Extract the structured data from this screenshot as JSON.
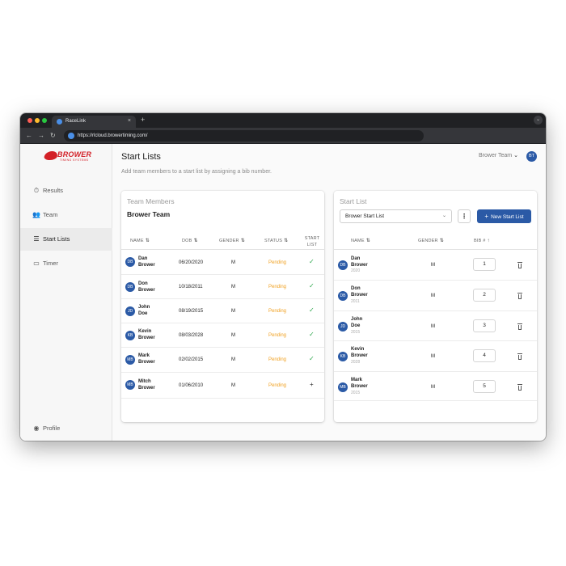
{
  "browser": {
    "tab_title": "RaceLink",
    "tab_close": "×",
    "new_tab": "+",
    "tab_menu": "⌄",
    "url": "https://rlcloud.browertiming.com/",
    "back": "←",
    "forward": "→",
    "reload": "↻"
  },
  "logo": {
    "brand": "BROWER",
    "sub": "TIMING SYSTEMS"
  },
  "sidebar": {
    "items": [
      {
        "label": "Results",
        "icon": "stopwatch-icon",
        "glyph": "⏱"
      },
      {
        "label": "Team",
        "icon": "team-icon",
        "glyph": "👥"
      },
      {
        "label": "Start Lists",
        "icon": "list-icon",
        "glyph": "☰"
      },
      {
        "label": "Timer",
        "icon": "camera-icon",
        "glyph": "▭"
      }
    ],
    "profile": {
      "label": "Profile",
      "glyph": "◉"
    }
  },
  "header": {
    "title": "Start Lists",
    "subtitle": "Add team members to a start list by assigning a bib number.",
    "team_switch": "Brower Team",
    "avatar": "BT"
  },
  "team_members": {
    "label": "Team Members",
    "team_name": "Brower Team",
    "columns": {
      "name": "NAME",
      "dob": "DOB",
      "gender": "GENDER",
      "status": "STATUS",
      "start_list_1": "START",
      "start_list_2": "LIST"
    },
    "sort_glyph": "⇅",
    "rows": [
      {
        "initials": "DB",
        "first": "Dan",
        "last": "Brower",
        "dob": "06/20/2020",
        "gender": "M",
        "status": "Pending",
        "action": "✓"
      },
      {
        "initials": "DB",
        "first": "Don",
        "last": "Brower",
        "dob": "10/18/2011",
        "gender": "M",
        "status": "Pending",
        "action": "✓"
      },
      {
        "initials": "JD",
        "first": "John",
        "last": "Doe",
        "dob": "08/19/2015",
        "gender": "M",
        "status": "Pending",
        "action": "✓"
      },
      {
        "initials": "KB",
        "first": "Kevin",
        "last": "Brower",
        "dob": "08/03/2028",
        "gender": "M",
        "status": "Pending",
        "action": "✓"
      },
      {
        "initials": "MB",
        "first": "Mark",
        "last": "Brower",
        "dob": "02/02/2015",
        "gender": "M",
        "status": "Pending",
        "action": "✓"
      },
      {
        "initials": "MB",
        "first": "Mitch",
        "last": "Brower",
        "dob": "01/06/2010",
        "gender": "M",
        "status": "Pending",
        "action": "+"
      }
    ]
  },
  "start_list": {
    "label": "Start List",
    "selected": "Brower Start List",
    "select_chevron": "⌄",
    "kebab": "⋮",
    "new_button": "New Start List",
    "new_plus": "+",
    "columns": {
      "name": "NAME",
      "gender": "GENDER",
      "bib": "BIB #"
    },
    "sort_glyph": "⇅",
    "bib_sort_glyph": "↑",
    "rows": [
      {
        "initials": "DB",
        "first": "Dan",
        "last": "Brower",
        "year": "2020",
        "gender": "M",
        "bib": "1"
      },
      {
        "initials": "DB",
        "first": "Don",
        "last": "Brower",
        "year": "2011",
        "gender": "M",
        "bib": "2"
      },
      {
        "initials": "JD",
        "first": "John",
        "last": "Doe",
        "year": "2015",
        "gender": "M",
        "bib": "3"
      },
      {
        "initials": "KB",
        "first": "Kevin",
        "last": "Brower",
        "year": "2028",
        "gender": "M",
        "bib": "4"
      },
      {
        "initials": "MB",
        "first": "Mark",
        "last": "Brower",
        "year": "2015",
        "gender": "M",
        "bib": "5"
      }
    ]
  },
  "colors": {
    "accent": "#2b5aa6",
    "brand_red": "#d32027",
    "pending": "#f0a020",
    "check": "#2fa84f"
  }
}
